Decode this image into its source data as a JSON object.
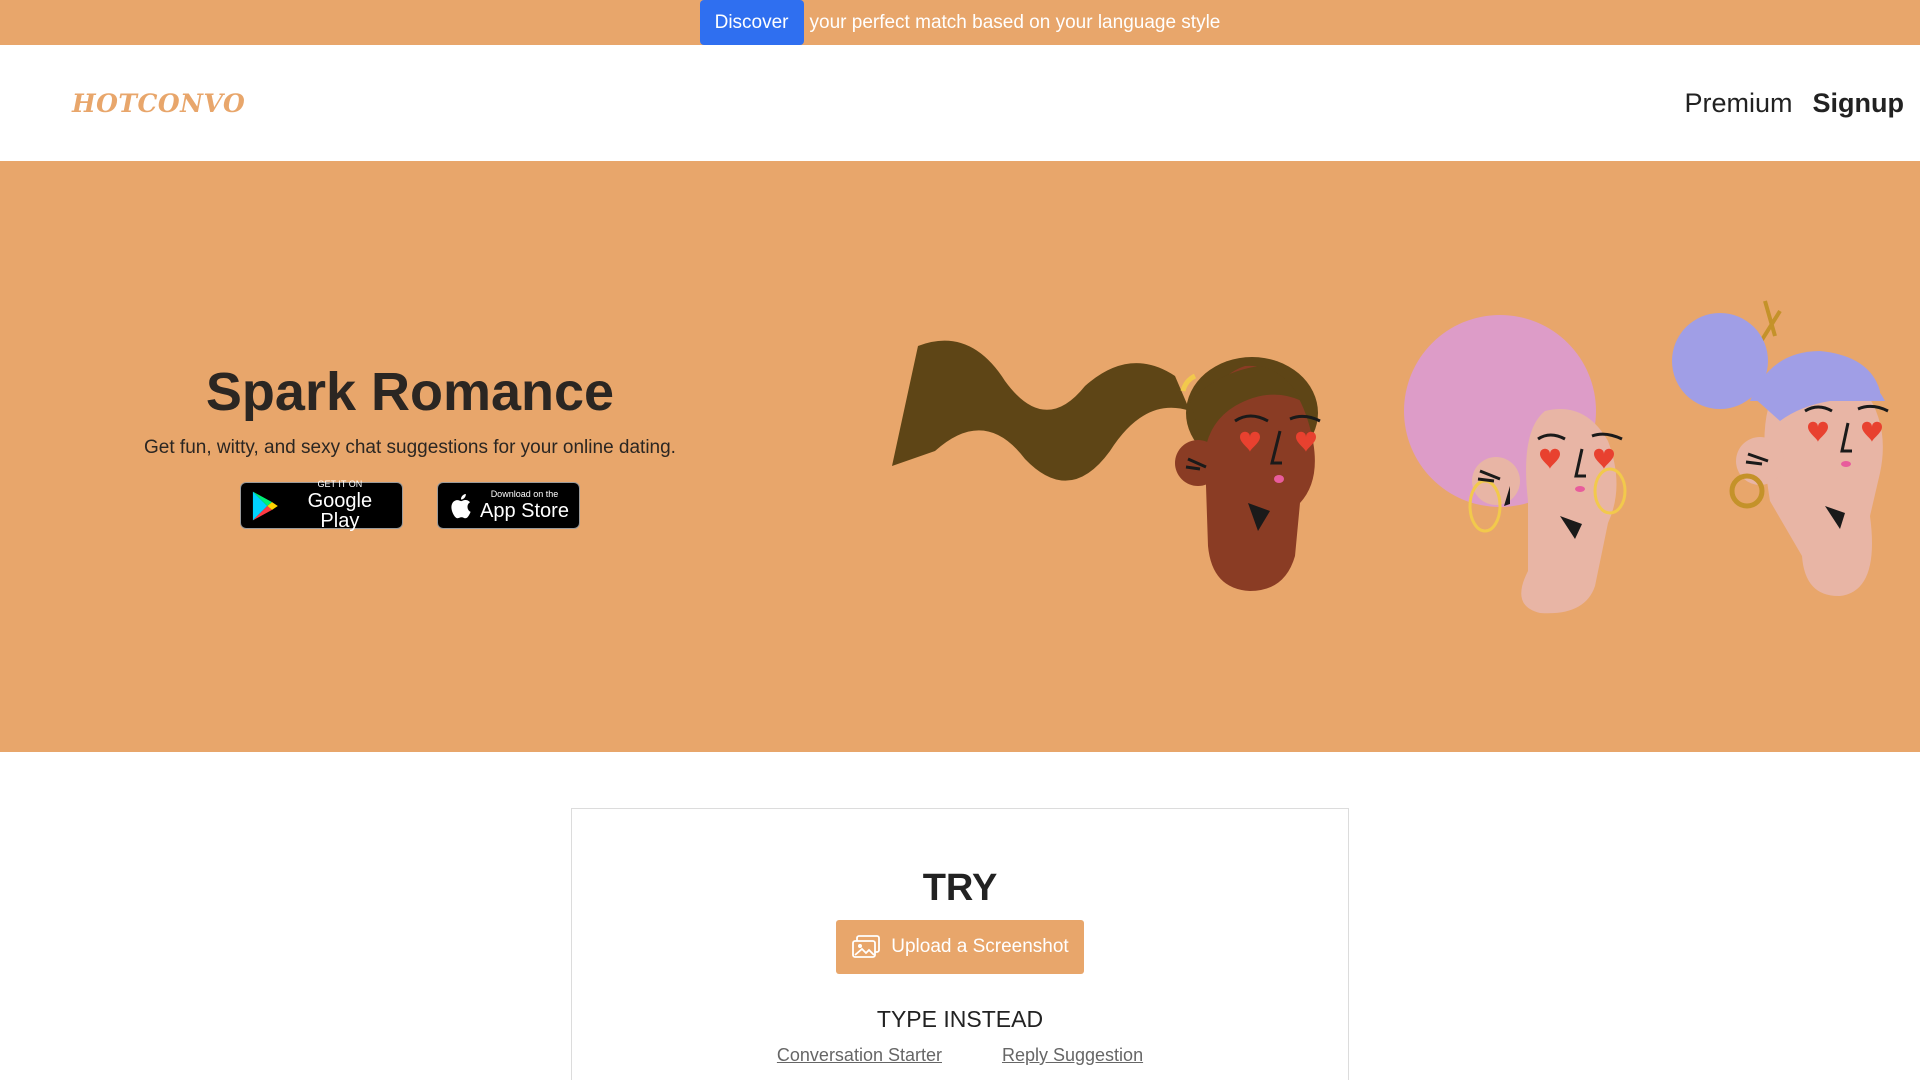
{
  "announcement": {
    "button_label": "Discover",
    "text": "your perfect match based on your language style"
  },
  "navbar": {
    "logo": "HOTCONVO",
    "links": [
      {
        "label": "Premium"
      },
      {
        "label": "Signup"
      }
    ]
  },
  "hero": {
    "title": "Spark Romance",
    "subtitle": "Get fun, witty, and sexy chat suggestions for your online dating.",
    "google_play": {
      "small": "GET IT ON",
      "big": "Google Play"
    },
    "app_store": {
      "small": "Download on the",
      "big": "App Store"
    }
  },
  "try_section": {
    "title": "TRY",
    "upload_label": "Upload a Screenshot",
    "type_instead": "TYPE INSTEAD",
    "links": [
      {
        "label": "Conversation Starter"
      },
      {
        "label": "Reply Suggestion"
      }
    ]
  },
  "colors": {
    "brand_orange": "#e8a66b",
    "discover_blue": "#2f6ff0",
    "heart_red": "#e8412f"
  }
}
